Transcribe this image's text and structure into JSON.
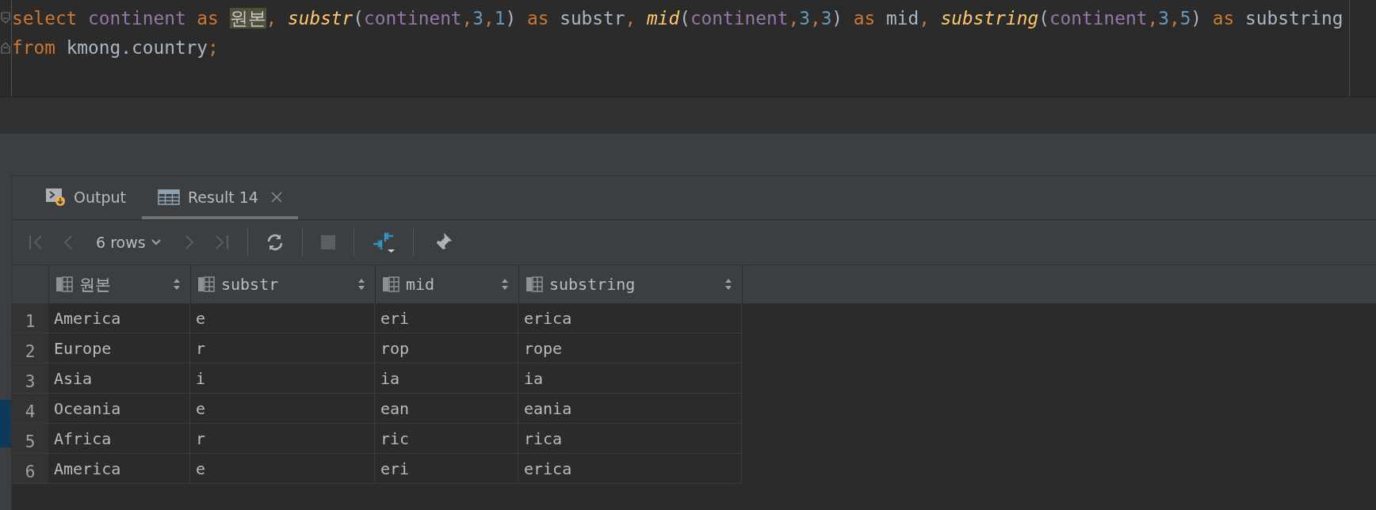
{
  "editor": {
    "lines": [
      {
        "tokens": [
          {
            "kind": "keyword",
            "text": "select "
          },
          {
            "kind": "identifier",
            "text": "continent "
          },
          {
            "kind": "keyword",
            "text": "as "
          },
          {
            "kind": "highlight",
            "text": "원본"
          },
          {
            "kind": "keyword",
            "text": ", "
          },
          {
            "kind": "function",
            "text": "substr"
          },
          {
            "kind": "plain",
            "text": "("
          },
          {
            "kind": "identifier",
            "text": "continent"
          },
          {
            "kind": "keyword",
            "text": ","
          },
          {
            "kind": "number",
            "text": "3"
          },
          {
            "kind": "keyword",
            "text": ","
          },
          {
            "kind": "number",
            "text": "1"
          },
          {
            "kind": "plain",
            "text": ") "
          },
          {
            "kind": "keyword",
            "text": "as"
          },
          {
            "kind": "plain",
            "text": " substr"
          },
          {
            "kind": "keyword",
            "text": ", "
          },
          {
            "kind": "function",
            "text": "mid"
          },
          {
            "kind": "plain",
            "text": "("
          },
          {
            "kind": "identifier",
            "text": "continent"
          },
          {
            "kind": "keyword",
            "text": ","
          },
          {
            "kind": "number",
            "text": "3"
          },
          {
            "kind": "keyword",
            "text": ","
          },
          {
            "kind": "number",
            "text": "3"
          },
          {
            "kind": "plain",
            "text": ") "
          },
          {
            "kind": "keyword",
            "text": "as"
          },
          {
            "kind": "plain",
            "text": " mid"
          },
          {
            "kind": "keyword",
            "text": ", "
          },
          {
            "kind": "function",
            "text": "substring"
          },
          {
            "kind": "plain",
            "text": "("
          },
          {
            "kind": "identifier",
            "text": "continent"
          },
          {
            "kind": "keyword",
            "text": ","
          },
          {
            "kind": "number",
            "text": "3"
          },
          {
            "kind": "keyword",
            "text": ","
          },
          {
            "kind": "number",
            "text": "5"
          },
          {
            "kind": "plain",
            "text": ") "
          },
          {
            "kind": "keyword",
            "text": "as"
          },
          {
            "kind": "plain",
            "text": " substring"
          }
        ]
      },
      {
        "tokens": [
          {
            "kind": "keyword",
            "text": "from"
          },
          {
            "kind": "plain",
            "text": " kmong.country"
          },
          {
            "kind": "keyword",
            "text": ";"
          }
        ]
      }
    ]
  },
  "tabs": [
    {
      "label": "Output",
      "kind": "output",
      "selected": false
    },
    {
      "label": "Result 14",
      "kind": "result",
      "selected": true
    }
  ],
  "toolbar": {
    "rows_label": "6 rows"
  },
  "table": {
    "columns": [
      "원본",
      "substr",
      "mid",
      "substring"
    ],
    "rows": [
      {
        "number": "1",
        "cells": [
          "America",
          "e",
          "eri",
          "erica"
        ]
      },
      {
        "number": "2",
        "cells": [
          "Europe",
          "r",
          "rop",
          "rope"
        ]
      },
      {
        "number": "3",
        "cells": [
          "Asia",
          "i",
          "ia",
          "ia"
        ]
      },
      {
        "number": "4",
        "cells": [
          "Oceania",
          "e",
          "ean",
          "eania"
        ]
      },
      {
        "number": "5",
        "cells": [
          "Africa",
          "r",
          "ric",
          "rica"
        ]
      },
      {
        "number": "6",
        "cells": [
          "America",
          "e",
          "eri",
          "erica"
        ]
      }
    ]
  }
}
